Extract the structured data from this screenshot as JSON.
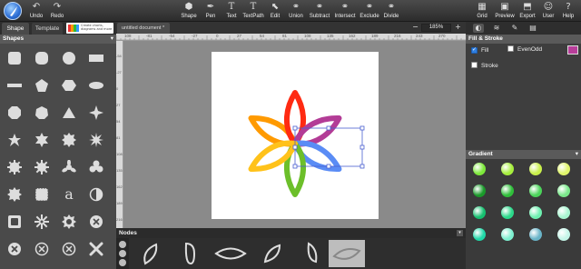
{
  "toolbar": {
    "undo": "Undo",
    "redo": "Redo",
    "tools": [
      "Shape",
      "Pen",
      "Text",
      "TextPath",
      "Edit",
      "Union",
      "Subtract",
      "Intersect",
      "Exclude",
      "Divide"
    ],
    "right": [
      "Grid",
      "Preview",
      "Export",
      "User",
      "Help"
    ]
  },
  "left": {
    "tab_shape": "Shape",
    "tab_template": "Template",
    "ad_text": "Create charts, diagrams and more",
    "shapes_header": "Shapes",
    "collapse": "▾",
    "letter_shape": "a"
  },
  "document": {
    "tab_name": "untitled document *",
    "zoom": "185%",
    "zoom_minus": "−",
    "zoom_plus": "+"
  },
  "ruler": {
    "top": [
      "108",
      "-81",
      "-54",
      "-27",
      "0",
      "27",
      "54",
      "81",
      "108",
      "135",
      "162",
      "189",
      "216",
      "243",
      "270"
    ],
    "left": [
      "-54",
      "-27",
      "0",
      "27",
      "54",
      "81",
      "108",
      "135",
      "162",
      "189",
      "216"
    ]
  },
  "flower": {
    "petal_colors": [
      "#ff9a00",
      "#ff2a12",
      "#b33c96",
      "#5a8cf5",
      "#6cbf2a",
      "#ffc21a"
    ]
  },
  "nodes": {
    "header": "Nodes",
    "collapse": "▾"
  },
  "fill_stroke": {
    "header": "Fill & Stroke",
    "fill_label": "Fill",
    "evenodd_label": "EvenOdd",
    "stroke_label": "Stroke",
    "fill_checked": true,
    "evenodd_checked": false,
    "stroke_checked": false,
    "fill_color": "#b83e9a"
  },
  "gradient": {
    "header": "Gradient",
    "collapse": "▾",
    "colors": [
      "#7de83a",
      "#a6ee3c",
      "#c9f04a",
      "#e0f56a",
      "#1a9a2a",
      "#2fbf3a",
      "#4bd45a",
      "#7ae88a",
      "#16c070",
      "#2bd88a",
      "#6ef0b0",
      "#a8f5d0",
      "#20d8a8",
      "#7ef0d0",
      "#6ab4c8",
      "#c4f5e8"
    ]
  }
}
